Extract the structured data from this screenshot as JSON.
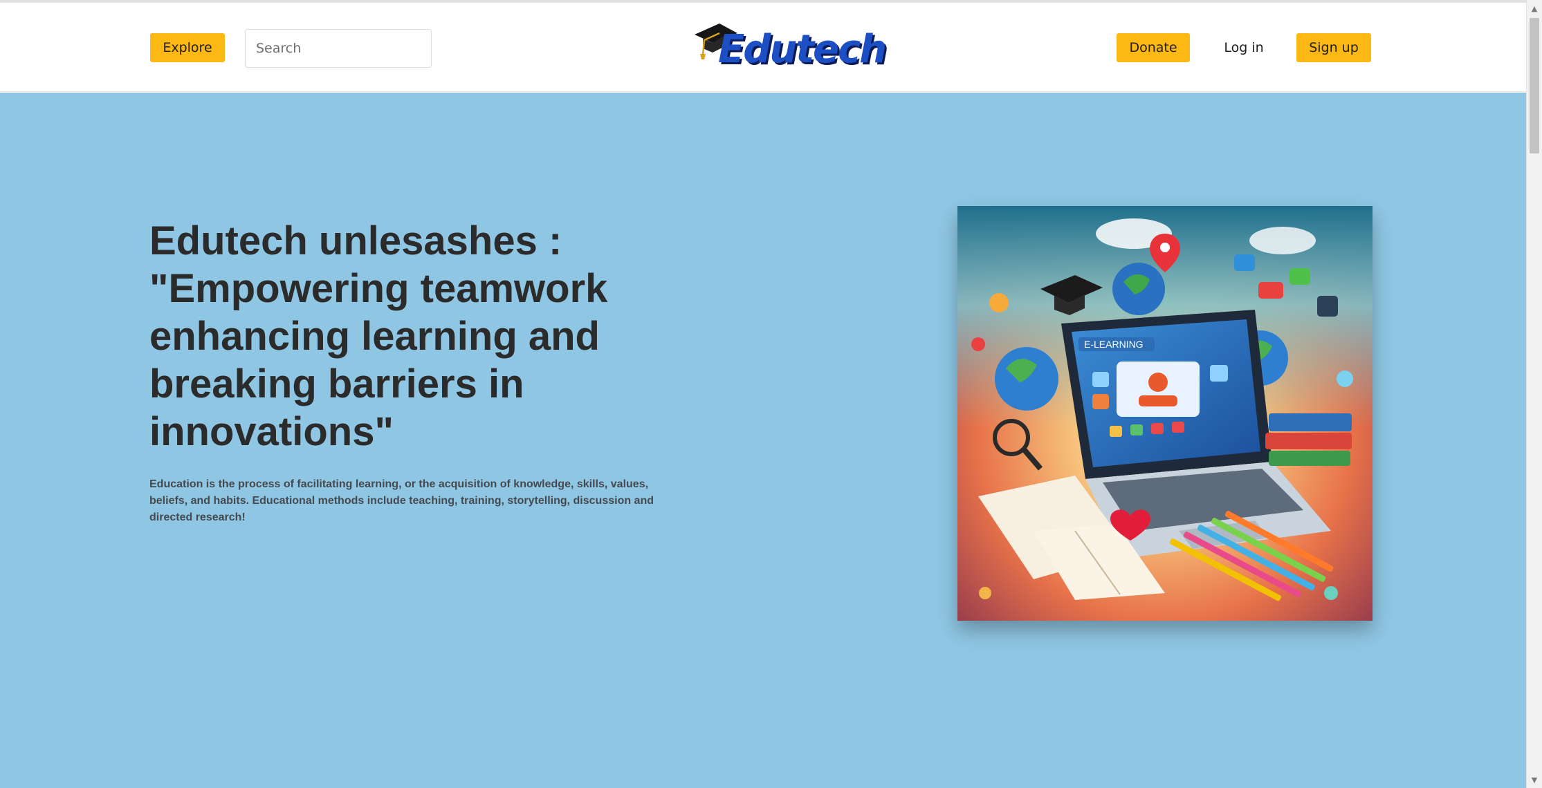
{
  "header": {
    "explore_label": "Explore",
    "search_placeholder": "Search",
    "logo_text": "Edutech",
    "donate_label": "Donate",
    "login_label": "Log in",
    "signup_label": "Sign up"
  },
  "hero": {
    "headline_lines": [
      "Edutech unlesashes :",
      "\"Empowering teamwork",
      "enhancing learning and",
      "breaking barriers in",
      "innovations\""
    ],
    "description": "Education is the process of facilitating learning, or the acquisition of knowledge, skills, values, beliefs, and habits. Educational methods include teaching, training, storytelling, discussion and directed research!",
    "image_label": "E-LEARNING"
  },
  "scrollbar": {
    "up_icon": "triangle-up-icon",
    "down_icon": "triangle-down-icon"
  },
  "colors": {
    "accent": "#fdb813",
    "hero_background": "#8fc6e3",
    "logo_blue": "#1c4fc4",
    "logo_shadow": "#0e1a52",
    "headline_text": "#2b2b2b"
  }
}
